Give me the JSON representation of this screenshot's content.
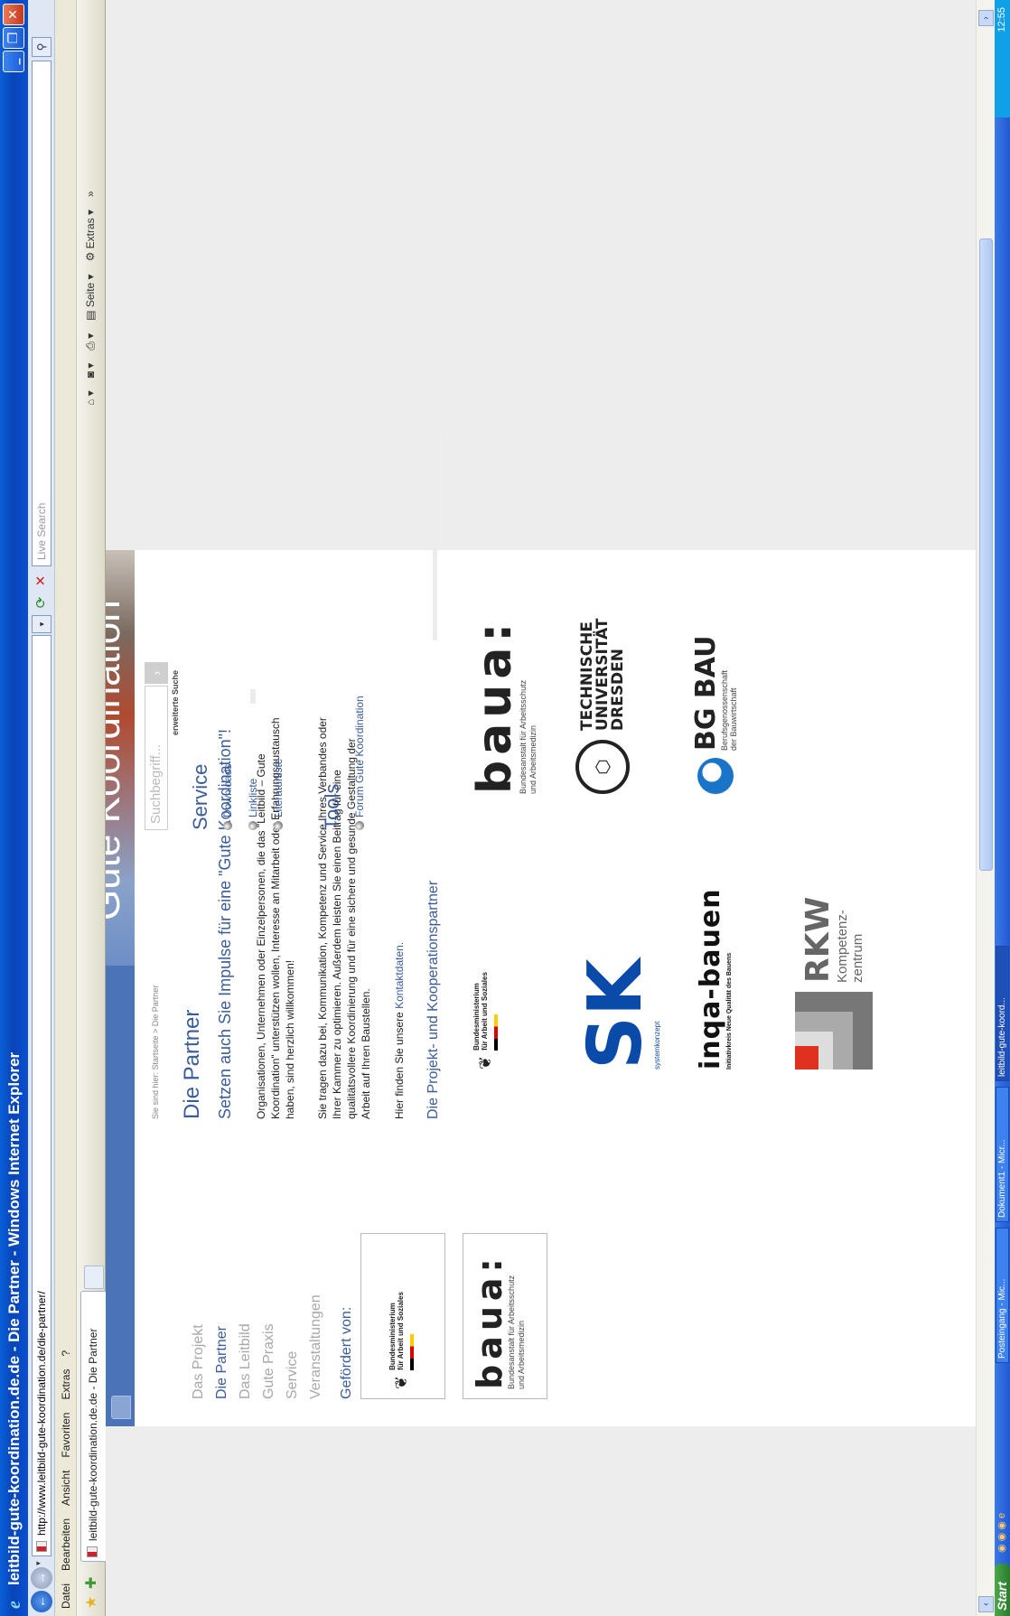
{
  "window": {
    "title": "leitbild-gute-koordination.de.de - Die Partner - Windows Internet Explorer"
  },
  "address": {
    "url": "http://www.leitbild-gute-koordination.de/die-partner/"
  },
  "search": {
    "placeholder": "Live Search"
  },
  "menu": [
    "Datei",
    "Bearbeiten",
    "Ansicht",
    "Favoriten",
    "Extras",
    "?"
  ],
  "tab": {
    "title": "leitbild-gute-koordination.de.de - Die Partner"
  },
  "command_bar": {
    "page": "Seite",
    "tools": "Extras"
  },
  "page": {
    "banner_text": "Gute Koordination",
    "nav": [
      "Das Projekt",
      "Die Partner",
      "Das Leitbild",
      "Gute Praxis",
      "Service",
      "Veranstaltungen"
    ],
    "nav_active": "Die Partner",
    "gefoerdert": "Gefördert von:",
    "breadcrumb": "Sie sind hier: Startseite > Die Partner",
    "title": "Die Partner",
    "subtitle": "Setzen auch Sie Impulse für eine \"Gute Koordination\"!",
    "para1": "Organisationen, Unternehmen oder Einzelpersonen, die das \"Leitbild – Gute Koordination\" unterstützen wollen, Interesse an Mitarbeit oder Erfahrungsaustausch haben, sind herzlich willkommen!",
    "para2": "Sie tragen dazu bei, Kommunikation, Kompetenz und Service Ihres Verbandes oder Ihrer Kammer zu optimieren. Außerdem leisten Sie einen Beitrag für eine qualitätsvollere Koordinierung und für eine sichere und gesunde Gestaltung der Arbeit auf Ihren Baustellen.",
    "para3_prefix": "Hier finden Sie unsere ",
    "para3_link": "Kontaktdaten.",
    "partners_heading": "Die Projekt- und Kooperationspartner",
    "search_placeholder": "Suchbegriff...",
    "advanced_search": "erweiterte Suche",
    "service_heading": "Service",
    "service_links": [
      "Downloads",
      "Linkliste",
      "Literaturliste"
    ],
    "tools_heading": "Tools",
    "tools_links": [
      "Forum Gute Koordination"
    ]
  },
  "logos": {
    "bmas_line1": "Bundesministerium",
    "bmas_line2": "für Arbeit und Soziales",
    "baua_big": "baua:",
    "baua_line1": "Bundesanstalt für Arbeitsschutz",
    "baua_line2": "und Arbeitsmedizin",
    "sk_text": "systemkonzept",
    "tud_line1": "TECHNISCHE",
    "tud_line2": "UNIVERSITÄT",
    "tud_line3": "DRESDEN",
    "inqa_big": "inqa-bauen",
    "inqa_small": "Initiativkreis Neue Qualität des Bauens",
    "bgbau_big": "BG BAU",
    "bgbau_line1": "Berufsgenossenschaft",
    "bgbau_line2": "der Bauwirtschaft",
    "rkw_big": "RKW",
    "rkw_line1": "Kompetenz-",
    "rkw_line2": "zentrum"
  },
  "taskbar": {
    "start": "Start",
    "items": [
      "Posteingang - Mic...",
      "Dokument1 - Micr...",
      "leitbild-gute-koord..."
    ],
    "clock": "12:55"
  }
}
